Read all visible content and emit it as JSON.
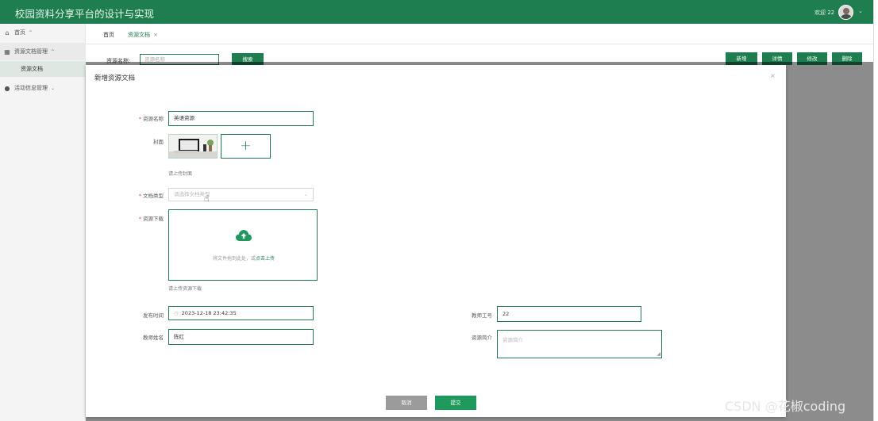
{
  "header": {
    "app_title": "校园资料分享平台的设计与实现",
    "welcome": "欢迎 22",
    "caret": "⌄"
  },
  "sidebar": {
    "items": [
      {
        "label": "首页",
        "icon": "home-icon",
        "arrow": "^"
      },
      {
        "label": "资源文档管理",
        "icon": "table-icon",
        "arrow": "^"
      },
      {
        "label": "资源文档"
      },
      {
        "label": "活动信息管理",
        "icon": "info-icon",
        "arrow": "⌄"
      }
    ]
  },
  "tabs": [
    {
      "label": "首页"
    },
    {
      "label": "资源文档",
      "close": "×"
    }
  ],
  "search": {
    "label": "资源名称:",
    "placeholder": "资源名称",
    "button": "搜索"
  },
  "toolbar": {
    "add": "新增",
    "detail": "详情",
    "edit": "修改",
    "delete": "删除"
  },
  "dialog": {
    "title": "新增资源文档",
    "close": "×",
    "fields": {
      "name_label": "资源名称",
      "name_value": "英语资源",
      "cover_label": "封面",
      "cover_add": "+",
      "cover_hint": "请上传封面",
      "type_label": "文档类型",
      "type_placeholder": "请选择文档类型",
      "download_label": "资源下载",
      "upload_text": "将文件拖到此处，或",
      "upload_link": "点击上传",
      "download_hint": "请上传资源下载",
      "publish_time_label": "发布时间",
      "publish_time_value": "2023-12-18 23:42:35",
      "teacher_id_label": "教师工号",
      "teacher_id_value": "22",
      "teacher_name_label": "教师姓名",
      "teacher_name_value": "陈红",
      "intro_label": "资源简介",
      "intro_placeholder": "资源简介"
    },
    "cancel": "取消",
    "submit": "提交"
  },
  "watermark": "CSDN @花椒coding",
  "colors": {
    "primary": "#1e7e4f",
    "submit": "#1e9a5c",
    "cancel": "#9b9b9b",
    "required": "#e34a4a"
  }
}
